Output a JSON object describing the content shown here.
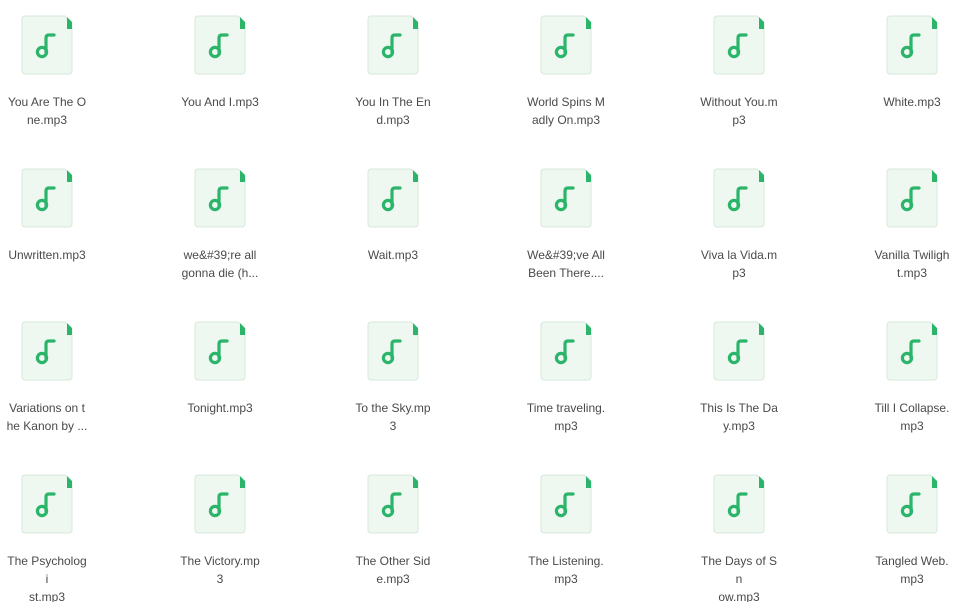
{
  "files": [
    {
      "name": "You Are The O\nne.mp3"
    },
    {
      "name": "You And I.mp3"
    },
    {
      "name": "You In The En\nd.mp3"
    },
    {
      "name": "World Spins M\nadly On.mp3"
    },
    {
      "name": "Without You.m\np3"
    },
    {
      "name": "White.mp3"
    },
    {
      "name": "Unwritten.mp3"
    },
    {
      "name": "we&#39;re all\ngonna die (h..."
    },
    {
      "name": "Wait.mp3"
    },
    {
      "name": "We&#39;ve All\nBeen There...."
    },
    {
      "name": "Viva la Vida.m\np3"
    },
    {
      "name": "Vanilla Twiligh\nt.mp3"
    },
    {
      "name": "Variations on t\nhe Kanon by ..."
    },
    {
      "name": "Tonight.mp3"
    },
    {
      "name": "To the Sky.mp\n3"
    },
    {
      "name": "Time traveling.\nmp3"
    },
    {
      "name": "This Is The Da\ny.mp3"
    },
    {
      "name": "Till I Collapse.\nmp3"
    },
    {
      "name": "The Psychologi\nst.mp3"
    },
    {
      "name": "The Victory.mp\n3"
    },
    {
      "name": "The Other Sid\ne.mp3"
    },
    {
      "name": "The Listening.\nmp3"
    },
    {
      "name": "The Days of Sn\now.mp3"
    },
    {
      "name": "Tangled Web.\nmp3"
    }
  ],
  "icon": {
    "name": "music-file-icon",
    "page_color": "#eef7f0",
    "border_color": "#d5e9da",
    "note_color": "#2bb56a"
  }
}
